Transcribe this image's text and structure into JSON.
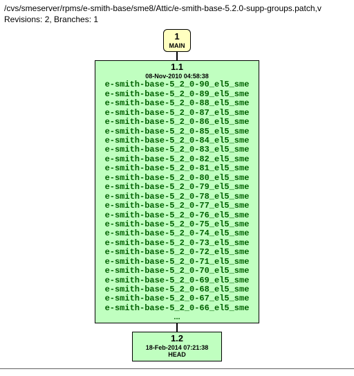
{
  "header": {
    "path": "/cvs/smeserver/rpms/e-smith-base/sme8/Attic/e-smith-base-5.2.0-supp-groups.patch,v",
    "revinfo": "Revisions: 2, Branches: 1"
  },
  "branch": {
    "num": "1",
    "name": "MAIN"
  },
  "rev1": {
    "num": "1.1",
    "date": "08-Nov-2010 04:58:38",
    "tags": [
      "e-smith-base-5_2_0-90_el5_sme",
      "e-smith-base-5_2_0-89_el5_sme",
      "e-smith-base-5_2_0-88_el5_sme",
      "e-smith-base-5_2_0-87_el5_sme",
      "e-smith-base-5_2_0-86_el5_sme",
      "e-smith-base-5_2_0-85_el5_sme",
      "e-smith-base-5_2_0-84_el5_sme",
      "e-smith-base-5_2_0-83_el5_sme",
      "e-smith-base-5_2_0-82_el5_sme",
      "e-smith-base-5_2_0-81_el5_sme",
      "e-smith-base-5_2_0-80_el5_sme",
      "e-smith-base-5_2_0-79_el5_sme",
      "e-smith-base-5_2_0-78_el5_sme",
      "e-smith-base-5_2_0-77_el5_sme",
      "e-smith-base-5_2_0-76_el5_sme",
      "e-smith-base-5_2_0-75_el5_sme",
      "e-smith-base-5_2_0-74_el5_sme",
      "e-smith-base-5_2_0-73_el5_sme",
      "e-smith-base-5_2_0-72_el5_sme",
      "e-smith-base-5_2_0-71_el5_sme",
      "e-smith-base-5_2_0-70_el5_sme",
      "e-smith-base-5_2_0-69_el5_sme",
      "e-smith-base-5_2_0-68_el5_sme",
      "e-smith-base-5_2_0-67_el5_sme",
      "e-smith-base-5_2_0-66_el5_sme"
    ],
    "ellipsis": "..."
  },
  "rev2": {
    "num": "1.2",
    "date": "18-Feb-2014 07:21:38",
    "head": "HEAD"
  },
  "chart_data": {
    "type": "table",
    "title": "CVS revision graph for e-smith-base-5.2.0-supp-groups.patch,v",
    "branches": [
      {
        "id": "1",
        "name": "MAIN"
      }
    ],
    "revisions": [
      {
        "rev": "1.1",
        "date": "08-Nov-2010 04:58:38",
        "branch": "MAIN",
        "tags": [
          "e-smith-base-5_2_0-90_el5_sme",
          "e-smith-base-5_2_0-89_el5_sme",
          "e-smith-base-5_2_0-88_el5_sme",
          "e-smith-base-5_2_0-87_el5_sme",
          "e-smith-base-5_2_0-86_el5_sme",
          "e-smith-base-5_2_0-85_el5_sme",
          "e-smith-base-5_2_0-84_el5_sme",
          "e-smith-base-5_2_0-83_el5_sme",
          "e-smith-base-5_2_0-82_el5_sme",
          "e-smith-base-5_2_0-81_el5_sme",
          "e-smith-base-5_2_0-80_el5_sme",
          "e-smith-base-5_2_0-79_el5_sme",
          "e-smith-base-5_2_0-78_el5_sme",
          "e-smith-base-5_2_0-77_el5_sme",
          "e-smith-base-5_2_0-76_el5_sme",
          "e-smith-base-5_2_0-75_el5_sme",
          "e-smith-base-5_2_0-74_el5_sme",
          "e-smith-base-5_2_0-73_el5_sme",
          "e-smith-base-5_2_0-72_el5_sme",
          "e-smith-base-5_2_0-71_el5_sme",
          "e-smith-base-5_2_0-70_el5_sme",
          "e-smith-base-5_2_0-69_el5_sme",
          "e-smith-base-5_2_0-68_el5_sme",
          "e-smith-base-5_2_0-67_el5_sme",
          "e-smith-base-5_2_0-66_el5_sme"
        ],
        "tags_truncated": true
      },
      {
        "rev": "1.2",
        "date": "18-Feb-2014 07:21:38",
        "branch": "MAIN",
        "tags": [
          "HEAD"
        ]
      }
    ]
  }
}
